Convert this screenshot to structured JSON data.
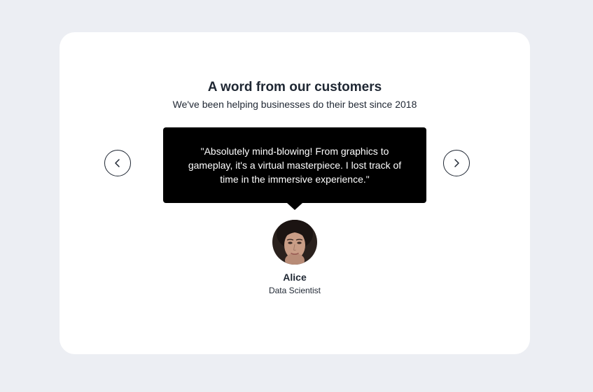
{
  "testimonials": {
    "title": "A word from our customers",
    "subtitle": "We've been helping businesses do their best since 2018",
    "quote": "\"Absolutely mind-blowing! From graphics to gameplay, it's a virtual masterpiece. I lost track of time in the immersive experience.\"",
    "author": {
      "name": "Alice",
      "role": "Data Scientist"
    },
    "nav": {
      "prev_icon": "chevron-left-icon",
      "next_icon": "chevron-right-icon"
    }
  },
  "colors": {
    "page_background": "#eceef3",
    "card_background": "#ffffff",
    "text": "#1f2733",
    "bubble_background": "#000000",
    "bubble_text": "#ffffff"
  }
}
